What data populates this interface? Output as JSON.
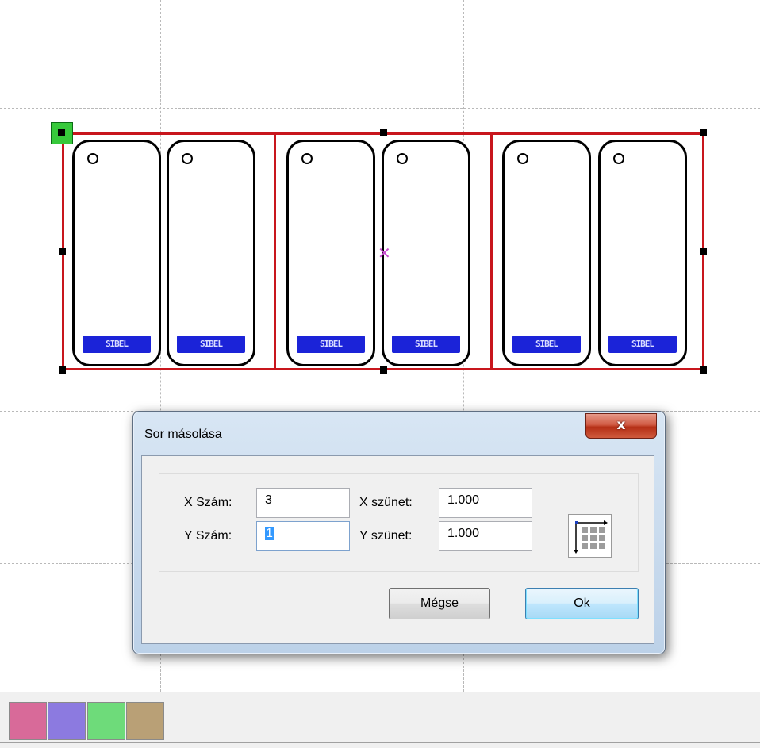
{
  "dialog": {
    "title": "Sor másolása",
    "close_glyph": "x",
    "fields": {
      "x_count_label": "X Szám:",
      "x_count_value": "3",
      "y_count_label": "Y Szám:",
      "y_count_value": "1",
      "x_gap_label": "X szünet:",
      "x_gap_value": "1.000",
      "y_gap_label": "Y szünet:",
      "y_gap_value": "1.000"
    },
    "layout_icon": "grid-direction-icon",
    "buttons": {
      "cancel_label": "Mégse",
      "ok_label": "Ok"
    }
  },
  "canvas": {
    "tag_label_text": "SIBEL",
    "tag_count": 6,
    "group_count": 3,
    "colors": {
      "frame": "#c8161d",
      "label_fill": "#1b23d8",
      "anchor": "#37c93b",
      "center_mark": "#c84ccf"
    }
  },
  "palette": {
    "swatches": [
      {
        "name": "pink",
        "color": "#d86a99"
      },
      {
        "name": "violet",
        "color": "#8c7ae0"
      },
      {
        "name": "green",
        "color": "#6edb7a"
      },
      {
        "name": "tan",
        "color": "#b9a076"
      }
    ]
  }
}
